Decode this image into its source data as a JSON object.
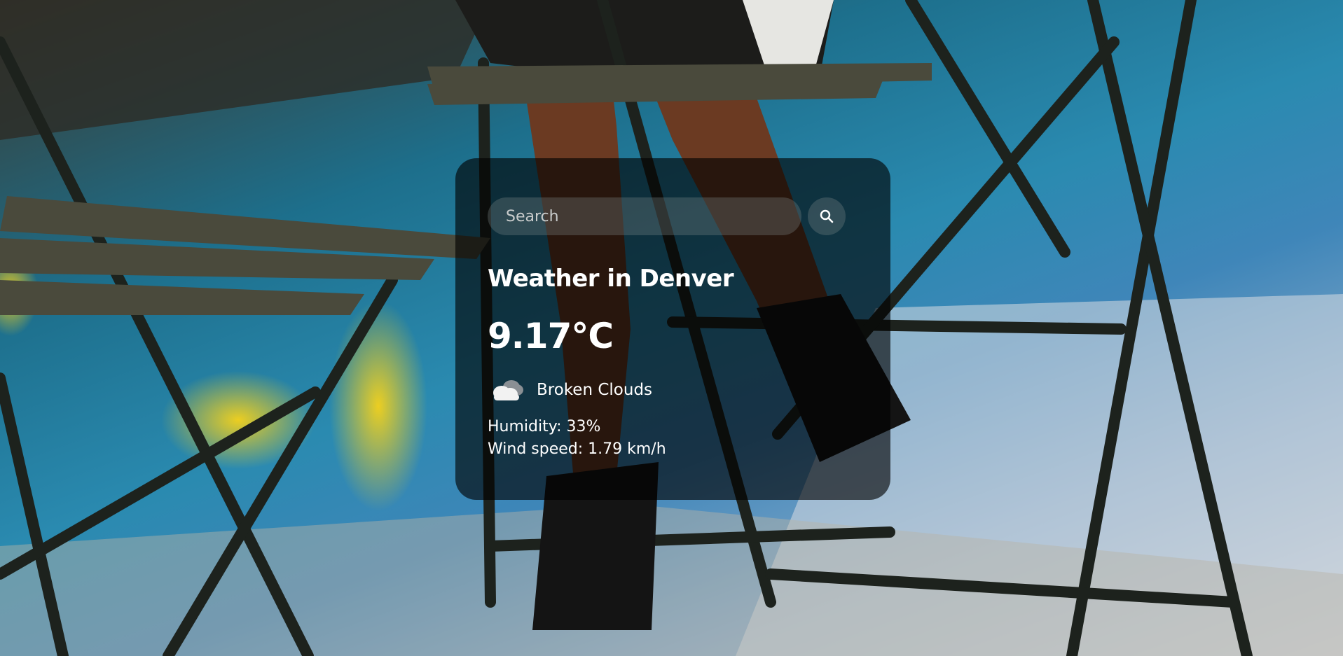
{
  "search": {
    "placeholder": "Search"
  },
  "weather": {
    "title": "Weather in Denver",
    "temperature": "9.17°C",
    "description": "Broken Clouds",
    "icon": "broken-clouds-icon",
    "humidity": "Humidity: 33%",
    "wind": "Wind speed: 1.79 km/h"
  },
  "colors": {
    "card_background": "rgba(0,0,0,0.62)",
    "input_background": "rgba(125,136,137,0.32)",
    "text": "#ffffff"
  }
}
